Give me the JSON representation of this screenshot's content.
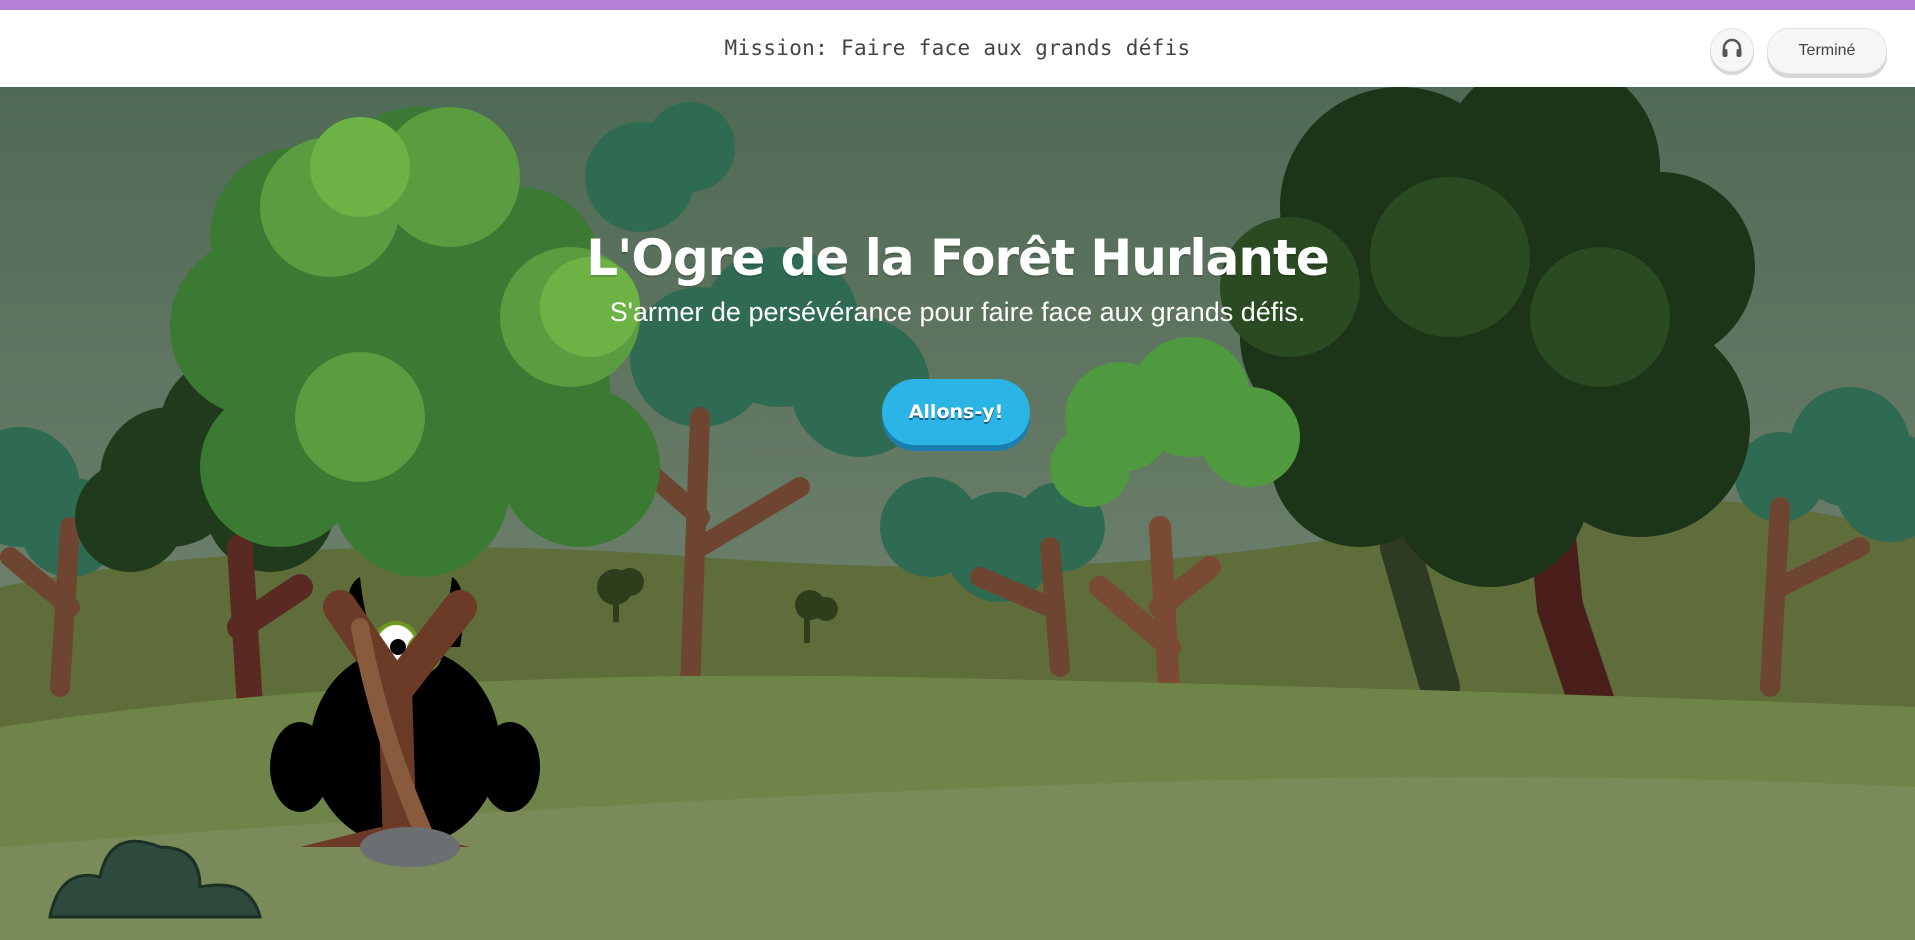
{
  "header": {
    "mission": "Mission: Faire face aux grands défis",
    "audio_icon": "headphones-icon",
    "done_label": "Terminé"
  },
  "hero": {
    "title": "L'Ogre de la Forêt Hurlante",
    "subtitle": "S'armer de persévérance pour faire face aux grands défis.",
    "start_label": "Allons-y!"
  },
  "colors": {
    "accent_bar": "#b57fd6",
    "start_button": "#2bb4e6",
    "sky": "#5d735f",
    "ground": "#7a8a55"
  }
}
